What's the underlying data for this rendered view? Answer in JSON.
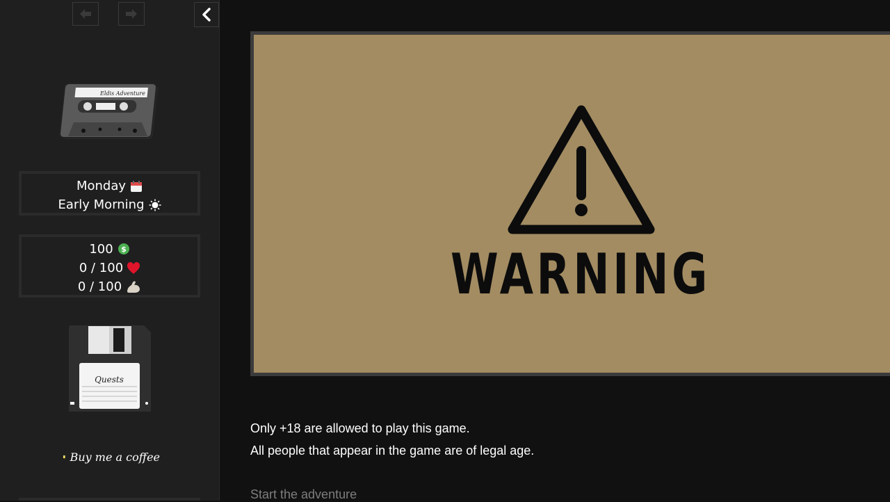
{
  "sidebar": {
    "time": {
      "day": "Monday",
      "period": "Early Morning"
    },
    "stats": {
      "money": "100",
      "love": "0 / 100",
      "energy": "0 / 100"
    },
    "cassette_label": "Eldis Adventure",
    "quests_label": "Quests",
    "coffee_label": "Buy me a coffee"
  },
  "main": {
    "warning_title": "WARNING",
    "notice_lines": [
      "Only +18 are allowed to play this game.",
      "All people that appear in the game are of legal age."
    ],
    "start_label": "Start the adventure"
  },
  "colors": {
    "background": "#111111",
    "sidebar": "#1f1f1f",
    "warning_panel": "#a38c62",
    "accent_green": "#4caf50",
    "accent_red": "#e0142b"
  }
}
